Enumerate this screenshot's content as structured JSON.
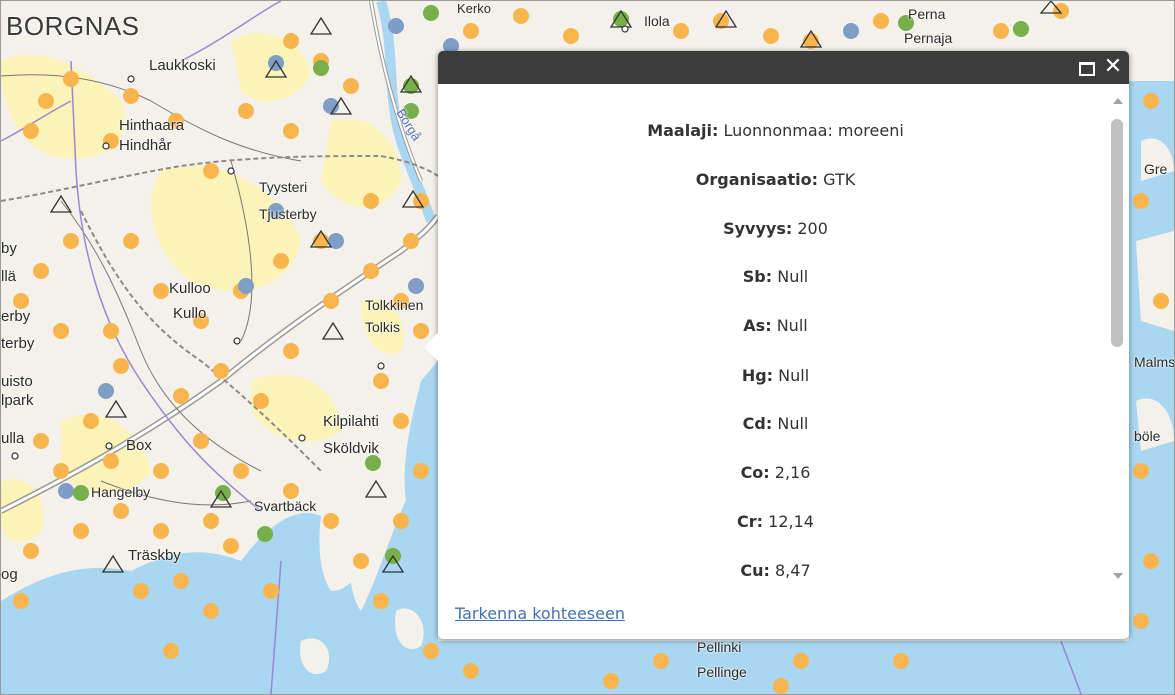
{
  "map": {
    "places": [
      {
        "id": "borgnas",
        "text": "BORGNAS"
      },
      {
        "id": "laukkoski",
        "text": "Laukkoski"
      },
      {
        "id": "hinthaara",
        "text": "Hinthaara"
      },
      {
        "id": "hindhar",
        "text": "Hindhår"
      },
      {
        "id": "tyysteri",
        "text": "Tyysteri"
      },
      {
        "id": "tjusterby",
        "text": "Tjusterby"
      },
      {
        "id": "kulloo",
        "text": "Kulloo"
      },
      {
        "id": "kullo",
        "text": "Kullo"
      },
      {
        "id": "tolkkinen",
        "text": "Tolkkinen"
      },
      {
        "id": "tolkis",
        "text": "Tolkis"
      },
      {
        "id": "kilpilahti",
        "text": "Kilpilahti"
      },
      {
        "id": "skoldvik",
        "text": "Sköldvik"
      },
      {
        "id": "box",
        "text": "Box"
      },
      {
        "id": "hangelby",
        "text": "Hangelby"
      },
      {
        "id": "svartback",
        "text": "Svartbäck"
      },
      {
        "id": "traskby",
        "text": "Träskby"
      },
      {
        "id": "ilola",
        "text": "Ilola"
      },
      {
        "id": "pernaja",
        "text": "Pernaja"
      },
      {
        "id": "perna",
        "text": "Perna"
      },
      {
        "id": "pellinki",
        "text": "Pellinki"
      },
      {
        "id": "pellinge",
        "text": "Pellinge"
      },
      {
        "id": "kerko",
        "text": "Kerko"
      },
      {
        "id": "borga-road",
        "text": "Borgå"
      },
      {
        "id": "gre",
        "text": "Gre"
      },
      {
        "id": "malms",
        "text": "Malms"
      },
      {
        "id": "bole",
        "text": "böle"
      },
      {
        "id": "ulla",
        "text": "ulla"
      },
      {
        "id": "uisto",
        "text": "uisto"
      },
      {
        "id": "park",
        "text": "lpark"
      },
      {
        "id": "terby",
        "text": "terby"
      },
      {
        "id": "by",
        "text": "by"
      },
      {
        "id": "la",
        "text": "llä"
      },
      {
        "id": "og",
        "text": "og"
      },
      {
        "id": "erby2",
        "text": "erby"
      }
    ]
  },
  "popup": {
    "attributes": [
      {
        "label": "Maalaji:",
        "value": "Luonnonmaa: moreeni"
      },
      {
        "label": "Organisaatio:",
        "value": "GTK"
      },
      {
        "label": "Syvyys:",
        "value": "200"
      },
      {
        "label": "Sb:",
        "value": "Null"
      },
      {
        "label": "As:",
        "value": "Null"
      },
      {
        "label": "Hg:",
        "value": "Null"
      },
      {
        "label": "Cd:",
        "value": "Null"
      },
      {
        "label": "Co:",
        "value": "2,16"
      },
      {
        "label": "Cr:",
        "value": "12,14"
      },
      {
        "label": "Cu:",
        "value": "8,47"
      }
    ],
    "zoom_link": "Tarkenna kohteeseen",
    "close_symbol": "✕",
    "scroll_position": 0.0
  },
  "colors": {
    "sea": "#a9d6f0",
    "land": "#f3f1ea",
    "field": "#fcf3b8",
    "orange_point": "#f9b54d",
    "blue_point": "#7f9ec6",
    "green_point": "#77b04a",
    "popup_header": "#3c3c3c",
    "link": "#4471b0"
  }
}
